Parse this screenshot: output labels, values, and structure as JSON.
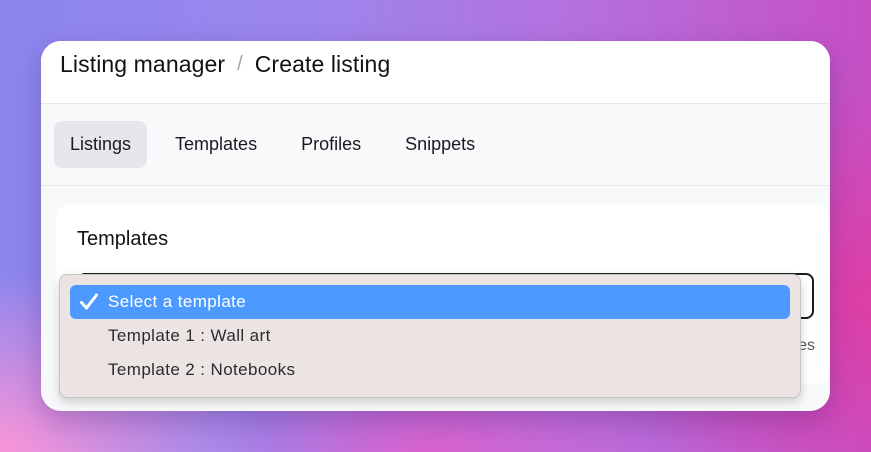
{
  "breadcrumb": {
    "root": "Listing manager",
    "separator": "/",
    "current": "Create listing"
  },
  "tabs": [
    {
      "label": "Listings",
      "active": true
    },
    {
      "label": "Templates",
      "active": false
    },
    {
      "label": "Profiles",
      "active": false
    },
    {
      "label": "Snippets",
      "active": false
    }
  ],
  "templates_card": {
    "title": "Templates",
    "helper_text": "es"
  },
  "template_select": {
    "options": [
      {
        "label": "Select a template",
        "selected": true
      },
      {
        "label": "Template 1 : Wall art",
        "selected": false
      },
      {
        "label": "Template 2 : Notebooks",
        "selected": false
      }
    ]
  },
  "colors": {
    "accent": "#4c9aff",
    "menu_bg": "#ebe4e3",
    "active_tab_bg": "#e5e7eb"
  },
  "icons": {
    "selected_option": "check-icon"
  }
}
